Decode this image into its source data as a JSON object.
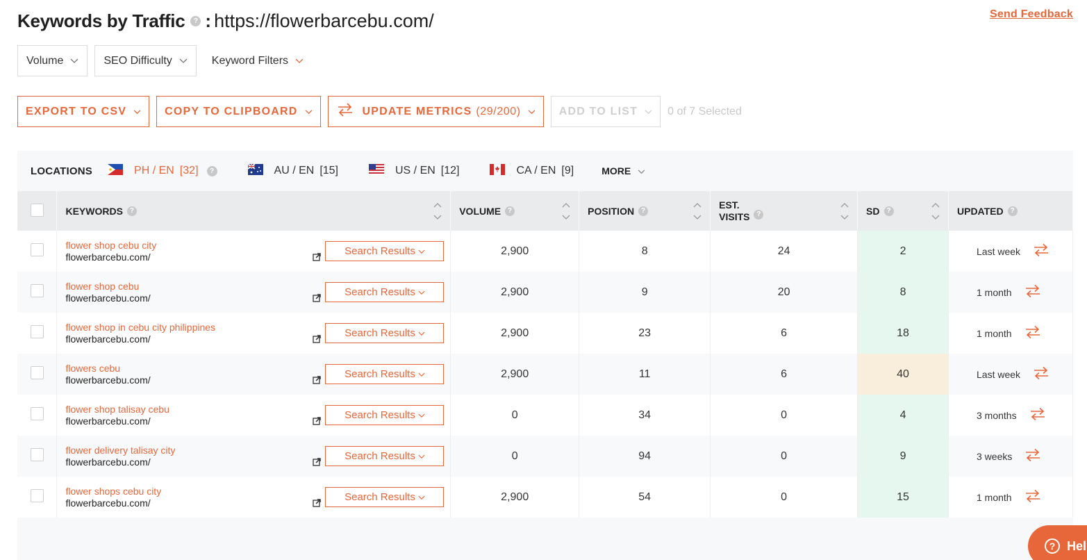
{
  "header": {
    "title": "Keywords by Traffic",
    "colon": ":",
    "url": "https://flowerbarcebu.com/",
    "help_glyph": "?",
    "feedback_label": "Send Feedback"
  },
  "filters": [
    {
      "label": "Volume"
    },
    {
      "label": "SEO Difficulty"
    },
    {
      "label": "Keyword Filters"
    }
  ],
  "actions": {
    "export_label": "EXPORT TO CSV",
    "copy_label": "COPY TO CLIPBOARD",
    "update_label": "UPDATE METRICS",
    "update_count": "(29/200)",
    "add_label": "ADD TO LIST",
    "selected_text": "0 of 7 Selected"
  },
  "locations": {
    "label": "LOCATIONS",
    "items": [
      {
        "code": "PH / EN",
        "count": "[32]",
        "flag": "philippines-flag-icon",
        "active": true
      },
      {
        "code": "AU / EN",
        "count": "[15]",
        "flag": "australia-flag-icon",
        "active": false
      },
      {
        "code": "US / EN",
        "count": "[12]",
        "flag": "usa-flag-icon",
        "active": false
      },
      {
        "code": "CA / EN",
        "count": "[9]",
        "flag": "canada-flag-icon",
        "active": false
      }
    ],
    "more_label": "MORE"
  },
  "table": {
    "headers": {
      "keywords": "KEYWORDS",
      "volume": "VOLUME",
      "position": "POSITION",
      "visits_line1": "EST.",
      "visits_line2": "VISITS",
      "sd": "SD",
      "updated": "UPDATED"
    },
    "search_results_label": "Search Results",
    "rows": [
      {
        "keyword": "flower shop cebu city",
        "url": "flowerbarcebu.com/",
        "volume": "2,900",
        "position": "8",
        "visits": "24",
        "sd": "2",
        "sd_level": "easy",
        "updated": "Last week"
      },
      {
        "keyword": "flower shop cebu",
        "url": "flowerbarcebu.com/",
        "volume": "2,900",
        "position": "9",
        "visits": "20",
        "sd": "8",
        "sd_level": "easy",
        "updated": "1 month"
      },
      {
        "keyword": "flower shop in cebu city philippines",
        "url": "flowerbarcebu.com/",
        "volume": "2,900",
        "position": "23",
        "visits": "6",
        "sd": "18",
        "sd_level": "easy",
        "updated": "1 month"
      },
      {
        "keyword": "flowers cebu",
        "url": "flowerbarcebu.com/",
        "volume": "2,900",
        "position": "11",
        "visits": "6",
        "sd": "40",
        "sd_level": "medium",
        "updated": "Last week"
      },
      {
        "keyword": "flower shop talisay cebu",
        "url": "flowerbarcebu.com/",
        "volume": "0",
        "position": "34",
        "visits": "0",
        "sd": "4",
        "sd_level": "easy",
        "updated": "3 months"
      },
      {
        "keyword": "flower delivery talisay city",
        "url": "flowerbarcebu.com/",
        "volume": "0",
        "position": "94",
        "visits": "0",
        "sd": "9",
        "sd_level": "easy",
        "updated": "3 weeks"
      },
      {
        "keyword": "flower shops cebu city",
        "url": "flowerbarcebu.com/",
        "volume": "2,900",
        "position": "54",
        "visits": "0",
        "sd": "15",
        "sd_level": "easy",
        "updated": "1 month"
      }
    ]
  },
  "help_widget": {
    "label": "Hel",
    "icon": "question-icon"
  },
  "colors": {
    "accent": "#e8673a",
    "sd_easy": "#e6f7ef",
    "sd_medium": "#f9eedc"
  }
}
